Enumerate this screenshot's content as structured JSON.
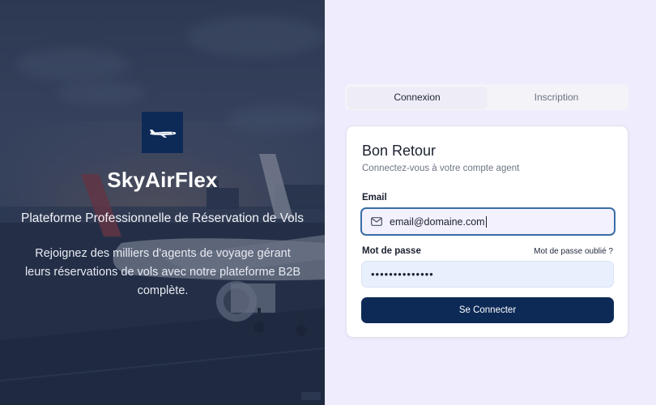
{
  "hero": {
    "brand": "SkyAirFlex",
    "tagline": "Plateforme Professionnelle de Réservation de Vols",
    "description": "Rejoignez des milliers d'agents de voyage gérant leurs réservations de vols avec notre plateforme B2B complète."
  },
  "tabs": [
    {
      "label": "Connexion",
      "active": true
    },
    {
      "label": "Inscription",
      "active": false
    }
  ],
  "login": {
    "title": "Bon Retour",
    "subtitle": "Connectez-vous à votre compte agent",
    "email_label": "Email",
    "email_value": "email@domaine.com",
    "password_label": "Mot de passe",
    "forgot_label": "Mot de passe oublié ?",
    "password_value": "••••••••••••••",
    "submit_label": "Se Connecter"
  },
  "colors": {
    "brand_navy": "#0d2a57",
    "right_background": "#efecfd",
    "focus_border": "#3a6ea5"
  }
}
